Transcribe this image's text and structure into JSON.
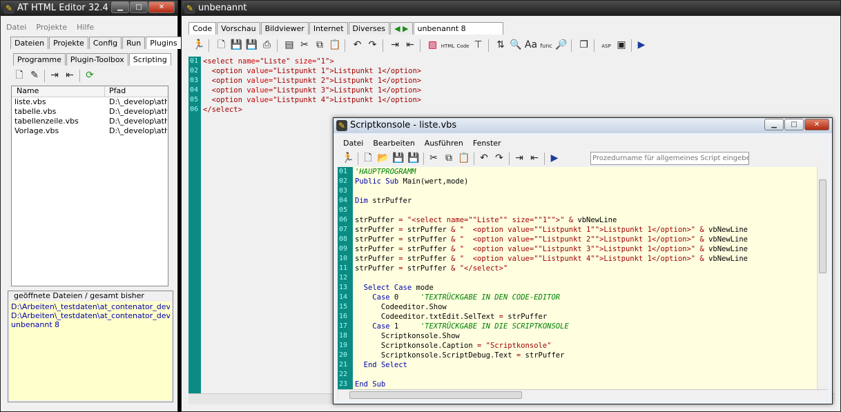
{
  "left_window": {
    "title": "AT HTML Editor 32.4",
    "menu": [
      "Datei",
      "Projekte",
      "Hilfe"
    ],
    "tabs_row1": [
      "Dateien",
      "Projekte",
      "Config",
      "Run",
      "Plugins"
    ],
    "tabs_row2": [
      "Programme",
      "Plugin-Toolbox",
      "Scripting"
    ],
    "list_headers": {
      "name": "Name",
      "path": "Pfad"
    },
    "files": [
      {
        "name": "liste.vbs",
        "path": "D:\\_develop\\athtm"
      },
      {
        "name": "tabelle.vbs",
        "path": "D:\\_develop\\athtm"
      },
      {
        "name": "tabellenzeile.vbs",
        "path": "D:\\_develop\\athtm"
      },
      {
        "name": "Vorlage.vbs",
        "path": "D:\\_develop\\athtm"
      }
    ],
    "opened_label": "geöffnete Dateien / gesamt bisher geöffnet",
    "opened": [
      "D:\\Arbeiten\\_testdaten\\at_contenator_develop\\w",
      "D:\\Arbeiten\\_testdaten\\at_contenator_develop\\w",
      "unbenannt 8"
    ]
  },
  "main_window": {
    "title": "unbenannt",
    "tabs": [
      "Code",
      "Vorschau",
      "Bildviewer",
      "Internet",
      "Diverses"
    ],
    "doc_tab": "unbenannt 8",
    "line_numbers": [
      "01",
      "02",
      "03",
      "04",
      "05",
      "06"
    ],
    "code": [
      [
        [
          "tg",
          "<select "
        ],
        [
          "at",
          "name="
        ],
        [
          "tg",
          "\"Liste\" "
        ],
        [
          "at",
          "size="
        ],
        [
          "tg",
          "\"1\">"
        ]
      ],
      [
        [
          "tx",
          "  "
        ],
        [
          "tg",
          "<option "
        ],
        [
          "at",
          "value="
        ],
        [
          "tg",
          "\"Listpunkt 1\">"
        ],
        [
          "str",
          "Listpunkt 1"
        ],
        [
          "tg",
          "</option>"
        ]
      ],
      [
        [
          "tx",
          "  "
        ],
        [
          "tg",
          "<option "
        ],
        [
          "at",
          "value="
        ],
        [
          "tg",
          "\"Listpunkt 2\">"
        ],
        [
          "str",
          "Listpunkt 1"
        ],
        [
          "tg",
          "</option>"
        ]
      ],
      [
        [
          "tx",
          "  "
        ],
        [
          "tg",
          "<option "
        ],
        [
          "at",
          "value="
        ],
        [
          "tg",
          "\"Listpunkt 3\">"
        ],
        [
          "str",
          "Listpunkt 1"
        ],
        [
          "tg",
          "</option>"
        ]
      ],
      [
        [
          "tx",
          "  "
        ],
        [
          "tg",
          "<option "
        ],
        [
          "at",
          "value="
        ],
        [
          "tg",
          "\"Listpunkt 4\">"
        ],
        [
          "str",
          "Listpunkt 1"
        ],
        [
          "tg",
          "</option>"
        ]
      ],
      [
        [
          "tg",
          "</select>"
        ]
      ]
    ]
  },
  "script_window": {
    "title": "Scriptkonsole - liste.vbs",
    "menu": [
      "Datei",
      "Bearbeiten",
      "Ausführen",
      "Fenster"
    ],
    "proc_placeholder": "Prozedurname für allgemeines Script eingeben",
    "line_numbers": [
      "01",
      "02",
      "03",
      "04",
      "05",
      "06",
      "07",
      "08",
      "09",
      "10",
      "11",
      "12",
      "13",
      "14",
      "15",
      "16",
      "17",
      "18",
      "19",
      "20",
      "21",
      "22",
      "23"
    ],
    "code": [
      [
        [
          "cm",
          "'HAUPTPROGRAMM"
        ]
      ],
      [
        [
          "kw",
          "Public Sub "
        ],
        [
          "tx",
          "Main(wert,mode)"
        ]
      ],
      [],
      [
        [
          "kw",
          "Dim "
        ],
        [
          "tx",
          "strPuffer"
        ]
      ],
      [],
      [
        [
          "tx",
          "strPuffer "
        ],
        [
          "str",
          "= \"<select name=\"\"Liste\"\" size=\"\"1\"\">\""
        ],
        [
          "tx",
          " "
        ],
        [
          "str",
          "&"
        ],
        [
          "tx",
          " vbNewLine"
        ]
      ],
      [
        [
          "tx",
          "strPuffer "
        ],
        [
          "str",
          "="
        ],
        [
          "tx",
          " strPuffer "
        ],
        [
          "str",
          "& \"  <option value=\"\"Listpunkt 1\"\">Listpunkt 1</option>\" &"
        ],
        [
          "tx",
          " vbNewLine"
        ]
      ],
      [
        [
          "tx",
          "strPuffer "
        ],
        [
          "str",
          "="
        ],
        [
          "tx",
          " strPuffer "
        ],
        [
          "str",
          "& \"  <option value=\"\"Listpunkt 2\"\">Listpunkt 1</option>\" &"
        ],
        [
          "tx",
          " vbNewLine"
        ]
      ],
      [
        [
          "tx",
          "strPuffer "
        ],
        [
          "str",
          "="
        ],
        [
          "tx",
          " strPuffer "
        ],
        [
          "str",
          "& \"  <option value=\"\"Listpunkt 3\"\">Listpunkt 1</option>\" &"
        ],
        [
          "tx",
          " vbNewLine"
        ]
      ],
      [
        [
          "tx",
          "strPuffer "
        ],
        [
          "str",
          "="
        ],
        [
          "tx",
          " strPuffer "
        ],
        [
          "str",
          "& \"  <option value=\"\"Listpunkt 4\"\">Listpunkt 1</option>\" &"
        ],
        [
          "tx",
          " vbNewLine"
        ]
      ],
      [
        [
          "tx",
          "strPuffer "
        ],
        [
          "str",
          "="
        ],
        [
          "tx",
          " strPuffer "
        ],
        [
          "str",
          "& \"</select>\""
        ]
      ],
      [],
      [
        [
          "tx",
          "  "
        ],
        [
          "kw",
          "Select Case "
        ],
        [
          "tx",
          "mode"
        ]
      ],
      [
        [
          "tx",
          "    "
        ],
        [
          "kw",
          "Case "
        ],
        [
          "tx",
          "0     "
        ],
        [
          "cm",
          "'TEXTRÜCKGABE IN DEN CODE-EDITOR"
        ]
      ],
      [
        [
          "tx",
          "      Codeeditor.Show"
        ]
      ],
      [
        [
          "tx",
          "      Codeeditor.txtEdit.SelText "
        ],
        [
          "str",
          "="
        ],
        [
          "tx",
          " strPuffer"
        ]
      ],
      [
        [
          "tx",
          "    "
        ],
        [
          "kw",
          "Case "
        ],
        [
          "tx",
          "1     "
        ],
        [
          "cm",
          "'TEXTRÜCKGABE IN DIE SCRIPTKONSOLE"
        ]
      ],
      [
        [
          "tx",
          "      Scriptkonsole.Show"
        ]
      ],
      [
        [
          "tx",
          "      Scriptkonsole.Caption "
        ],
        [
          "str",
          "= \"Scriptkonsole\""
        ]
      ],
      [
        [
          "tx",
          "      Scriptkonsole.ScriptDebug.Text "
        ],
        [
          "str",
          "="
        ],
        [
          "tx",
          " strPuffer"
        ]
      ],
      [
        [
          "tx",
          "  "
        ],
        [
          "kw",
          "End Select"
        ]
      ],
      [],
      [
        [
          "kw",
          "End Sub"
        ]
      ]
    ]
  }
}
